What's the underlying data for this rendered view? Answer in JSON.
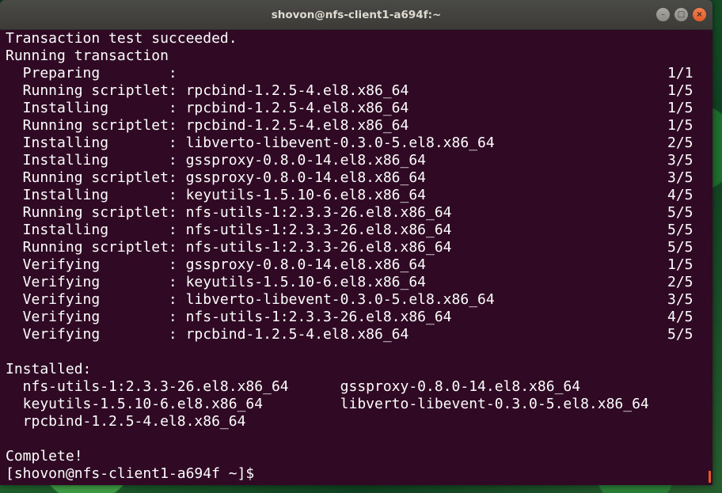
{
  "window": {
    "title": "shovon@nfs-client1-a694f:~",
    "controls": {
      "minimize": "–",
      "maximize": "□",
      "close": "×"
    }
  },
  "terminal": {
    "header": [
      "Transaction test succeeded.",
      "Running transaction"
    ],
    "steps": [
      {
        "text": "  Preparing        :",
        "count": "1/1"
      },
      {
        "text": "  Running scriptlet: rpcbind-1.2.5-4.el8.x86_64",
        "count": "1/5"
      },
      {
        "text": "  Installing       : rpcbind-1.2.5-4.el8.x86_64",
        "count": "1/5"
      },
      {
        "text": "  Running scriptlet: rpcbind-1.2.5-4.el8.x86_64",
        "count": "1/5"
      },
      {
        "text": "  Installing       : libverto-libevent-0.3.0-5.el8.x86_64",
        "count": "2/5"
      },
      {
        "text": "  Installing       : gssproxy-0.8.0-14.el8.x86_64",
        "count": "3/5"
      },
      {
        "text": "  Running scriptlet: gssproxy-0.8.0-14.el8.x86_64",
        "count": "3/5"
      },
      {
        "text": "  Installing       : keyutils-1.5.10-6.el8.x86_64",
        "count": "4/5"
      },
      {
        "text": "  Running scriptlet: nfs-utils-1:2.3.3-26.el8.x86_64",
        "count": "5/5"
      },
      {
        "text": "  Installing       : nfs-utils-1:2.3.3-26.el8.x86_64",
        "count": "5/5"
      },
      {
        "text": "  Running scriptlet: nfs-utils-1:2.3.3-26.el8.x86_64",
        "count": "5/5"
      },
      {
        "text": "  Verifying        : gssproxy-0.8.0-14.el8.x86_64",
        "count": "1/5"
      },
      {
        "text": "  Verifying        : keyutils-1.5.10-6.el8.x86_64",
        "count": "2/5"
      },
      {
        "text": "  Verifying        : libverto-libevent-0.3.0-5.el8.x86_64",
        "count": "3/5"
      },
      {
        "text": "  Verifying        : nfs-utils-1:2.3.3-26.el8.x86_64",
        "count": "4/5"
      },
      {
        "text": "  Verifying        : rpcbind-1.2.5-4.el8.x86_64",
        "count": "5/5"
      }
    ],
    "installed_heading": "Installed:",
    "installed_lines": [
      "  nfs-utils-1:2.3.3-26.el8.x86_64      gssproxy-0.8.0-14.el8.x86_64",
      "  keyutils-1.5.10-6.el8.x86_64         libverto-libevent-0.3.0-5.el8.x86_64",
      "  rpcbind-1.2.5-4.el8.x86_64"
    ],
    "complete": "Complete!",
    "prompt": "[shovon@nfs-client1-a694f ~]$"
  },
  "colors": {
    "terminal_bg": "#300a24",
    "text": "#ffffff",
    "titlebar": "#3c3b37",
    "close_button": "#e95420"
  }
}
